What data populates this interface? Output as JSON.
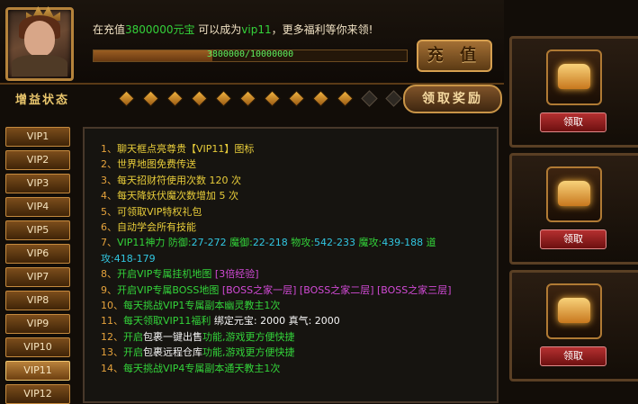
{
  "header": {
    "vip_text_prefix": "在充值",
    "vip_amount": "3800000元宝",
    "vip_text_mid": " 可以成为",
    "vip_level": "vip11",
    "vip_text_suffix": "，更多福利等你来领!",
    "progress_text": "3800000/10000000",
    "progress_fraction": 0.38,
    "recharge_label": "充 值"
  },
  "buff": {
    "label": "增益状态",
    "diamonds_active": 10,
    "diamonds_total": 13
  },
  "claim_reward_label": "领取奖励",
  "vip_tabs": [
    "VIP1",
    "VIP2",
    "VIP3",
    "VIP4",
    "VIP5",
    "VIP6",
    "VIP7",
    "VIP8",
    "VIP9",
    "VIP10",
    "VIP11",
    "VIP12"
  ],
  "active_tab": "VIP11",
  "benefits": [
    {
      "idx": "1、",
      "text": "聊天框点亮尊贵【VIP11】图标"
    },
    {
      "idx": "2、",
      "text": "世界地图免费传送"
    },
    {
      "idx": "3、",
      "text": "每天招财符使用次数 120 次"
    },
    {
      "idx": "4、",
      "text": "每天降妖伏魔次数增加 5 次"
    },
    {
      "idx": "5、",
      "text": "可领取VIP特权礼包"
    },
    {
      "idx": "6、",
      "text": "自动学会所有技能"
    },
    {
      "idx": "7、",
      "text": "VIP11神力 ",
      "stats": [
        {
          "label": "防御:",
          "value": "27-272"
        },
        {
          "label": "魔御:",
          "value": "22-218"
        },
        {
          "label": "物攻:",
          "value": "542-233"
        },
        {
          "label": "魔攻:",
          "value": "439-188"
        },
        {
          "label": "道",
          "value": ""
        }
      ],
      "wrap": "攻:418-179"
    },
    {
      "idx": "8、",
      "text": "开启VIP专属挂机地图 ",
      "extra": "[3倍经验]"
    },
    {
      "idx": "9、",
      "text": "开启VIP专属BOSS地图 ",
      "extra": "[BOSS之家一层] [BOSS之家二层] [BOSS之家三层]"
    },
    {
      "idx": "10、",
      "text": "每天挑战VIP1专属副本幽灵教主1次"
    },
    {
      "idx": "11、",
      "text": "每天领取VIP11福利 ",
      "extra": "绑定元宝: 2000  真气: 2000"
    },
    {
      "idx": "12、",
      "text": "开启",
      "em": "包裹一键出售",
      "text2": "功能,游戏更方便快捷"
    },
    {
      "idx": "13、",
      "text": "开启",
      "em": "包裹远程仓库",
      "text2": "功能,游戏更方便快捷"
    },
    {
      "idx": "14、",
      "text": "每天挑战VIP4专属副本通天教主1次"
    }
  ],
  "reward_cards": [
    {
      "icon": "treasure-chest-icon",
      "claim_label": "领取"
    },
    {
      "icon": "treasure-chest-icon",
      "claim_label": "领取"
    },
    {
      "icon": "treasure-chest-icon",
      "claim_label": "领取"
    }
  ]
}
